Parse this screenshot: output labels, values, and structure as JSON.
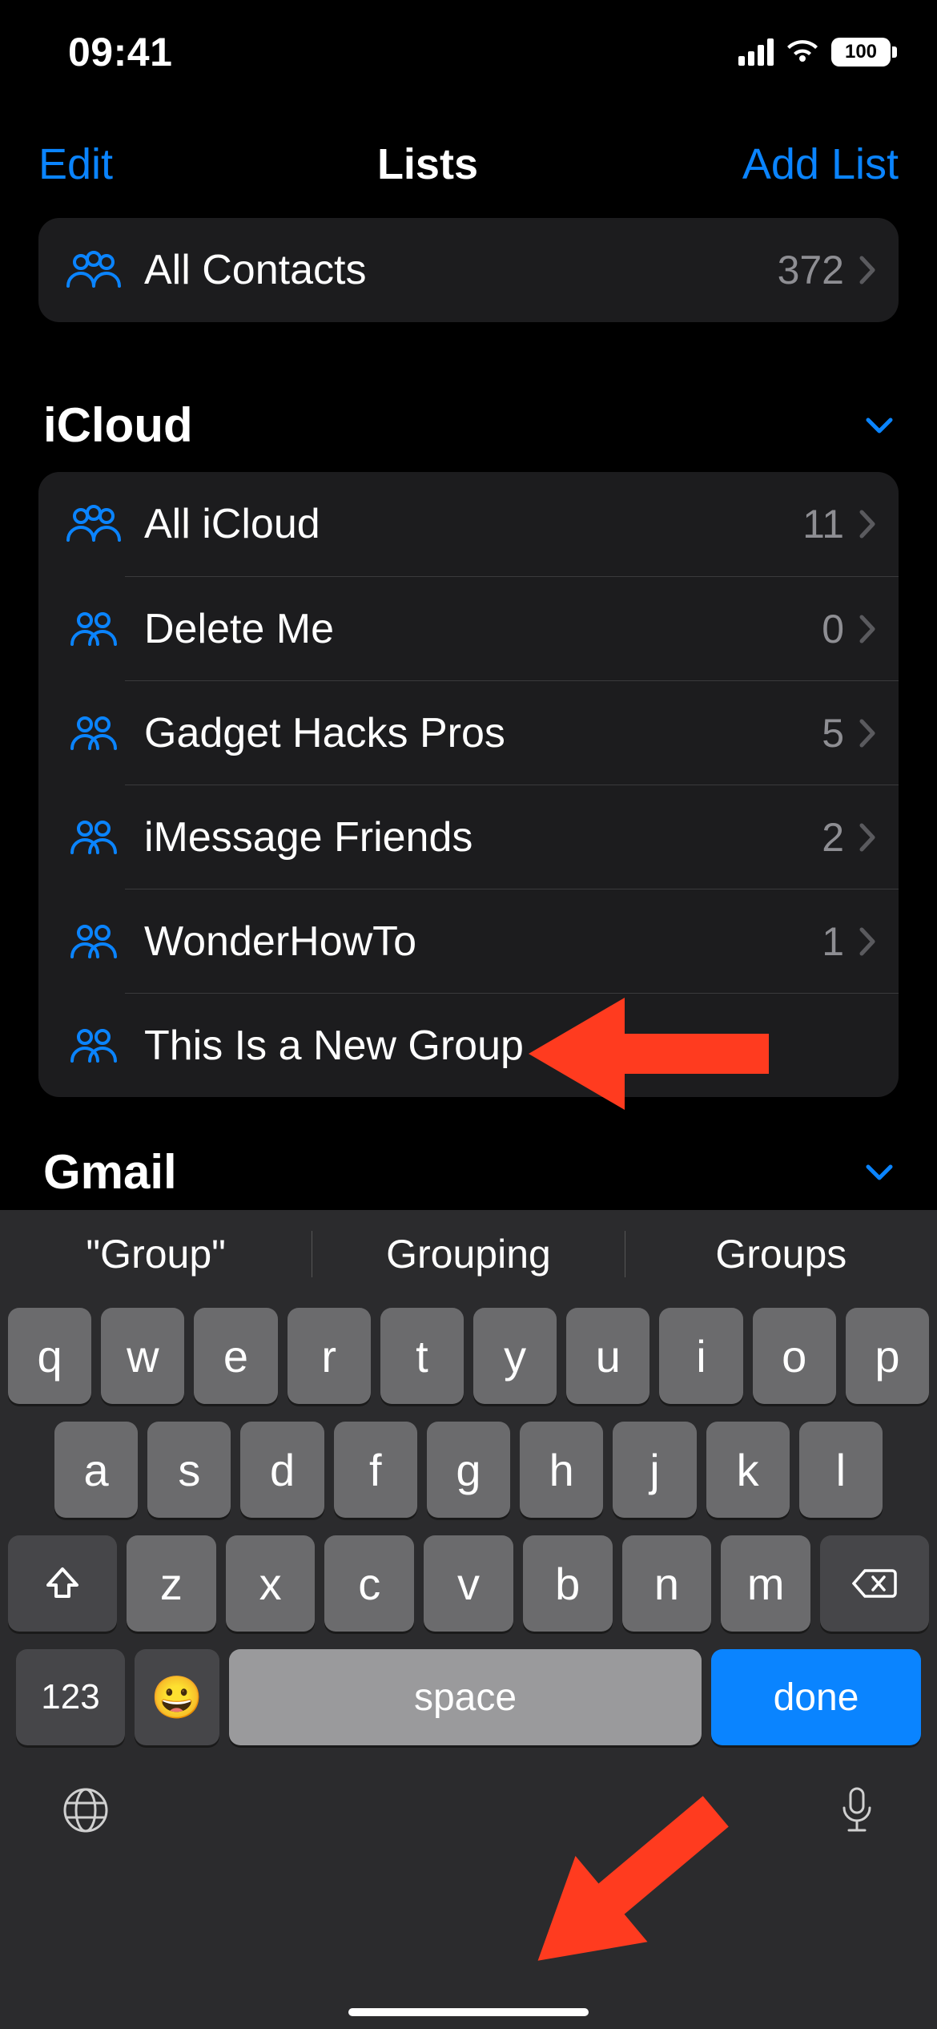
{
  "status": {
    "time": "09:41",
    "battery": "100"
  },
  "nav": {
    "left": "Edit",
    "title": "Lists",
    "right": "Add List"
  },
  "all_contacts": {
    "label": "All Contacts",
    "count": "372"
  },
  "sections": [
    {
      "title": "iCloud",
      "rows": [
        {
          "icon": "group3",
          "label": "All iCloud",
          "count": "11",
          "chevron": true
        },
        {
          "icon": "group2",
          "label": "Delete Me",
          "count": "0",
          "chevron": true
        },
        {
          "icon": "group2",
          "label": "Gadget Hacks Pros",
          "count": "5",
          "chevron": true
        },
        {
          "icon": "group2",
          "label": "iMessage Friends",
          "count": "2",
          "chevron": true
        },
        {
          "icon": "group2",
          "label": "WonderHowTo",
          "count": "1",
          "chevron": true
        },
        {
          "icon": "group2",
          "label": "This Is a New Group",
          "count": "",
          "chevron": false,
          "editing": true
        }
      ]
    },
    {
      "title": "Gmail",
      "rows": []
    }
  ],
  "keyboard": {
    "suggestions": [
      "\"Group\"",
      "Grouping",
      "Groups"
    ],
    "row1": [
      "q",
      "w",
      "e",
      "r",
      "t",
      "y",
      "u",
      "i",
      "o",
      "p"
    ],
    "row2": [
      "a",
      "s",
      "d",
      "f",
      "g",
      "h",
      "j",
      "k",
      "l"
    ],
    "row3": [
      "z",
      "x",
      "c",
      "v",
      "b",
      "n",
      "m"
    ],
    "numbers_label": "123",
    "space_label": "space",
    "done_label": "done"
  }
}
